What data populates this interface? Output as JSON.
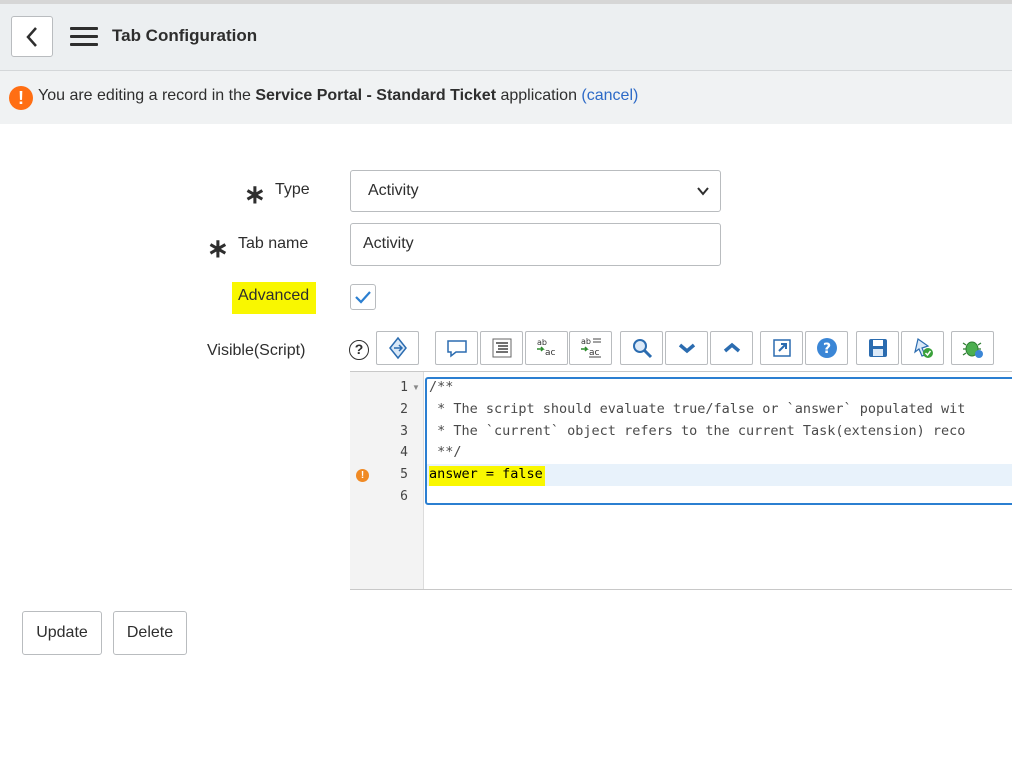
{
  "header": {
    "title": "Tab Configuration"
  },
  "notice": {
    "prefix": "You are editing a record in the ",
    "app_name": "Service Portal - Standard Ticket",
    "suffix": " application ",
    "cancel_link": "(cancel)"
  },
  "form": {
    "type_label": "Type",
    "type_value": "Activity",
    "tab_name_label": "Tab name",
    "tab_name_value": "Activity",
    "advanced_label": "Advanced",
    "advanced_checked": true,
    "visible_label": "Visible(Script)"
  },
  "toolbar": {
    "icons": [
      "toggle-syntax-icon",
      "comment-icon",
      "format-code-icon",
      "replace-icon",
      "replace-all-icon",
      "search-icon",
      "next-icon",
      "previous-icon",
      "fullscreen-icon",
      "help-icon",
      "save-icon",
      "script-debugger-icon",
      "debug-icon"
    ]
  },
  "editor": {
    "line_numbers": [
      "1",
      "2",
      "3",
      "4",
      "5",
      "6"
    ],
    "lines": [
      "/**",
      " * The script should evaluate true/false or `answer` populated wit",
      " * The `current` object refers to the current Task(extension) reco",
      " **/",
      "answer = false",
      ""
    ]
  },
  "actions": {
    "update_label": "Update",
    "delete_label": "Delete"
  },
  "colors": {
    "accent": "#2b7fd1",
    "warning": "#ff6e13",
    "highlight": "#f9f700"
  }
}
